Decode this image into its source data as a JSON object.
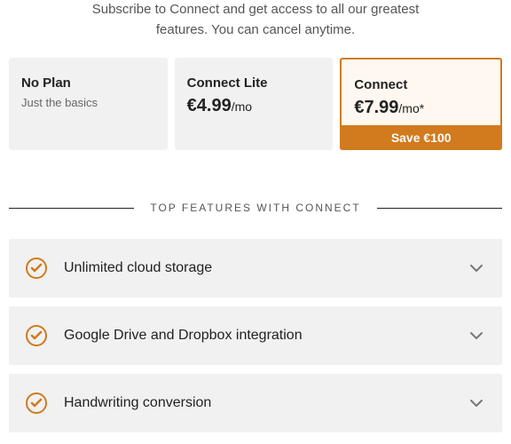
{
  "subtitle_line1": "Subscribe to Connect and get access to all our greatest",
  "subtitle_line2": "features. You can cancel anytime.",
  "plans": [
    {
      "title": "No Plan",
      "sub": "Just the basics"
    },
    {
      "title": "Connect Lite",
      "price": "€4.99",
      "per": "/mo"
    },
    {
      "title": "Connect",
      "price": "€7.99",
      "per": "/mo*",
      "save": "Save €100"
    }
  ],
  "features_header": "TOP FEATURES WITH CONNECT",
  "features": [
    {
      "label": "Unlimited cloud storage"
    },
    {
      "label": "Google Drive and Dropbox integration"
    },
    {
      "label": "Handwriting conversion"
    }
  ]
}
